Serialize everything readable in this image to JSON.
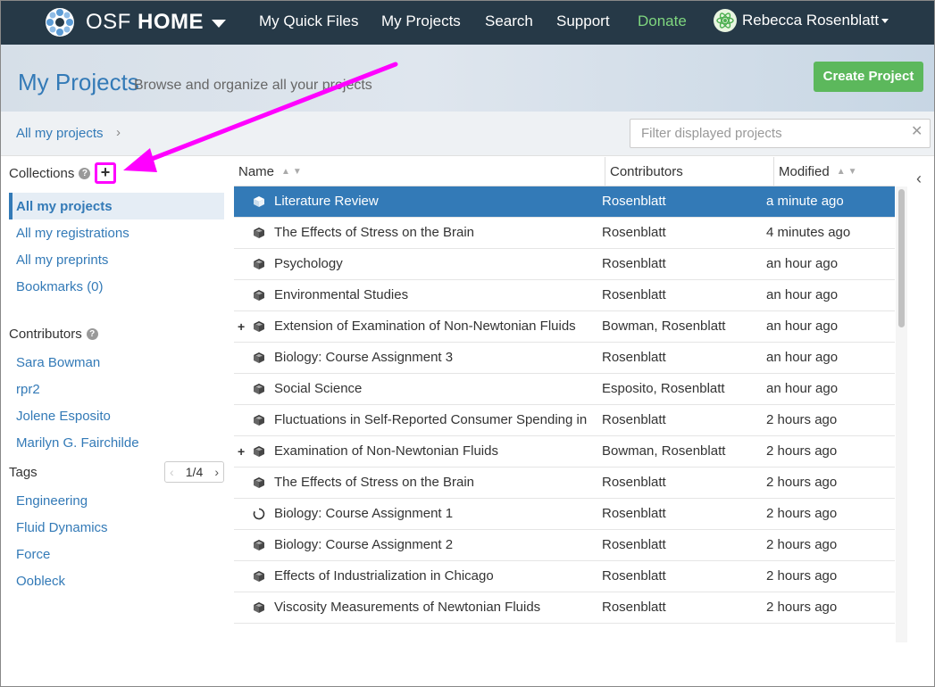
{
  "navbar": {
    "brand_light": "OSF",
    "brand_bold": "HOME",
    "links": [
      "My Quick Files",
      "My Projects",
      "Search",
      "Support",
      "Donate"
    ],
    "user_name": "Rebecca Rosenblatt"
  },
  "header": {
    "title": "My Projects",
    "subtitle": "Browse and organize all your projects",
    "create_button": "Create Project"
  },
  "breadcrumb": {
    "label": "All my projects",
    "chevron": "›"
  },
  "filter": {
    "placeholder": "Filter displayed projects"
  },
  "sidebar": {
    "collections_title": "Collections",
    "collections": [
      "All my projects",
      "All my registrations",
      "All my preprints",
      "Bookmarks (0)"
    ],
    "contributors_title": "Contributors",
    "contributors": [
      "Sara Bowman",
      "rpr2",
      "Jolene Esposito",
      "Marilyn G. Fairchilde"
    ],
    "tags_title": "Tags",
    "tags_page": "1/4",
    "tags": [
      "Engineering",
      "Fluid Dynamics",
      "Force",
      "Oobleck"
    ]
  },
  "table": {
    "columns": [
      "Name",
      "Contributors",
      "Modified"
    ],
    "rows": [
      {
        "name": "Literature Review",
        "contributors": "Rosenblatt",
        "modified": "a minute ago",
        "icon": "cube-icon",
        "expandable": false,
        "selected": true
      },
      {
        "name": "The Effects of Stress on the Brain",
        "contributors": "Rosenblatt",
        "modified": "4 minutes ago",
        "icon": "cube-icon",
        "expandable": false
      },
      {
        "name": "Psychology",
        "contributors": "Rosenblatt",
        "modified": "an hour ago",
        "icon": "cube-icon",
        "expandable": false
      },
      {
        "name": "Environmental Studies",
        "contributors": "Rosenblatt",
        "modified": "an hour ago",
        "icon": "cube-icon",
        "expandable": false
      },
      {
        "name": "Extension of Examination of Non-Newtonian Fluids",
        "contributors": "Bowman, Rosenblatt",
        "modified": "an hour ago",
        "icon": "cube-icon",
        "expandable": true
      },
      {
        "name": "Biology: Course Assignment 3",
        "contributors": "Rosenblatt",
        "modified": "an hour ago",
        "icon": "cube-icon",
        "expandable": false
      },
      {
        "name": "Social Science",
        "contributors": "Esposito, Rosenblatt",
        "modified": "an hour ago",
        "icon": "cube-icon",
        "expandable": false
      },
      {
        "name": "Fluctuations in Self-Reported Consumer Spending in ...",
        "contributors": "Rosenblatt",
        "modified": "2 hours ago",
        "icon": "cube-icon",
        "expandable": false
      },
      {
        "name": "Examination of Non-Newtonian Fluids",
        "contributors": "Bowman, Rosenblatt",
        "modified": "2 hours ago",
        "icon": "cube-icon",
        "expandable": true
      },
      {
        "name": "The Effects of Stress on the Brain",
        "contributors": "Rosenblatt",
        "modified": "2 hours ago",
        "icon": "cube-icon",
        "expandable": false
      },
      {
        "name": "Biology: Course Assignment 1",
        "contributors": "Rosenblatt",
        "modified": "2 hours ago",
        "icon": "circle-notch-icon",
        "expandable": false
      },
      {
        "name": "Biology: Course Assignment 2",
        "contributors": "Rosenblatt",
        "modified": "2 hours ago",
        "icon": "cube-icon",
        "expandable": false
      },
      {
        "name": "Effects of Industrialization in Chicago",
        "contributors": "Rosenblatt",
        "modified": "2 hours ago",
        "icon": "cube-icon",
        "expandable": false
      },
      {
        "name": "Viscosity Measurements of Newtonian Fluids",
        "contributors": "Rosenblatt",
        "modified": "2 hours ago",
        "icon": "cube-icon",
        "expandable": false
      }
    ]
  },
  "colors": {
    "navbar": "#263947",
    "link": "#337ab7",
    "selected_row": "#337ab7",
    "create_button": "#5cb85c",
    "donate": "#7fd67f",
    "annotation": "#ff00ff"
  }
}
